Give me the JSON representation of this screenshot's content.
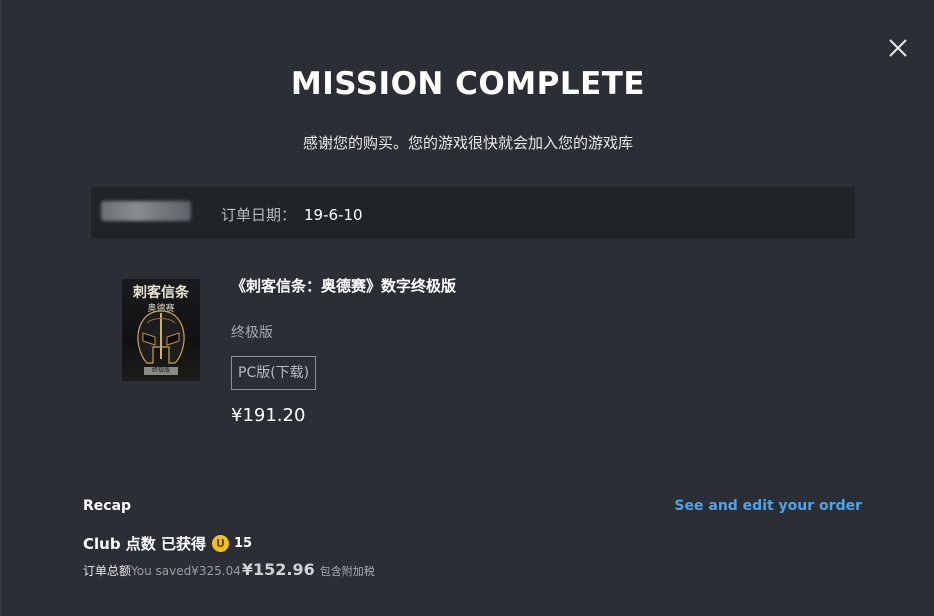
{
  "modal": {
    "title": "MISSION COMPLETE",
    "subtitle": "感谢您的购买。您的游戏很快就会加入您的游戏库",
    "close_icon": "close-icon"
  },
  "order": {
    "date_label": "订单日期：",
    "date_value": "19-6-10"
  },
  "product": {
    "cover_title": "刺客信条",
    "cover_subtitle": "奥德赛",
    "cover_band": "终极版",
    "name": "《刺客信条：奥德赛》数字终极版",
    "edition": "终极版",
    "platform": "PC版(下载)",
    "price": "¥191.20"
  },
  "recap": {
    "label": "Recap",
    "edit_link": "See and edit your order",
    "club_label": "Club 点数 已获得",
    "coin_glyph": "U",
    "club_points": "15",
    "total_label": "订单总额",
    "you_saved_label": "You saved",
    "saved_amount": "¥325.04",
    "total_amount": "¥152.96",
    "tax_note": "包含附加税"
  },
  "colors": {
    "background": "#2b2e35",
    "order_bar": "#202328",
    "link": "#4fa3e8",
    "coin": "#f2c21b"
  }
}
